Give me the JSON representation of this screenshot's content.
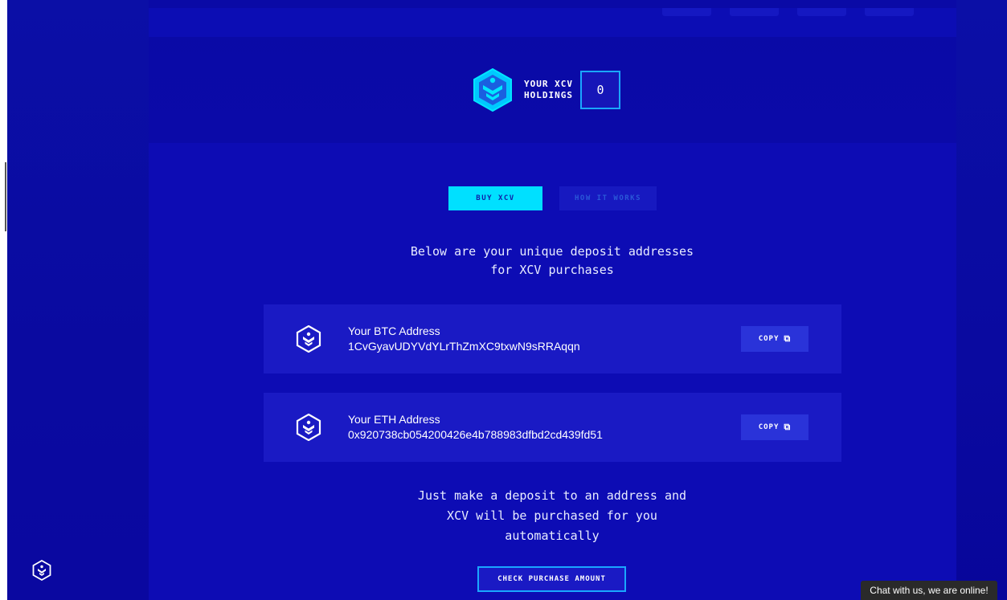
{
  "holdings": {
    "label_line1": "YOUR XCV",
    "label_line2": "HOLDINGS",
    "value": "0"
  },
  "tabs": [
    {
      "label": "BUY XCV",
      "active": true
    },
    {
      "label": "HOW IT WORKS",
      "active": false
    }
  ],
  "intro": {
    "line1": "Below are your unique deposit addresses",
    "line2": "for XCV purchases"
  },
  "addresses": [
    {
      "title": "Your BTC Address",
      "value": "1CvGyavUDYVdYLrThZmXC9txwN9sRRAqqn",
      "copy_label": "COPY"
    },
    {
      "title": "Your ETH Address",
      "value": "0x920738cb054200426e4b788983dfbd2cd439fd51",
      "copy_label": "COPY"
    }
  ],
  "outro": {
    "line1": "Just make a deposit to an address and",
    "line2": "XCV will be purchased for you",
    "line3": "automatically"
  },
  "check_button": {
    "label": "CHECK PURCHASE AMOUNT"
  },
  "chat": {
    "label": "Chat with us, we are online!"
  },
  "colors": {
    "background": "#0a0aa6",
    "panel": "#0d0cb4",
    "card": "#1a1ac4",
    "accent_cyan": "#00e0ff",
    "accent_border": "#1aa7ff",
    "copy_button": "#2a33d9"
  },
  "icons": {
    "brand": "xcv-hex-logo-icon",
    "copy": "copy-icon"
  }
}
